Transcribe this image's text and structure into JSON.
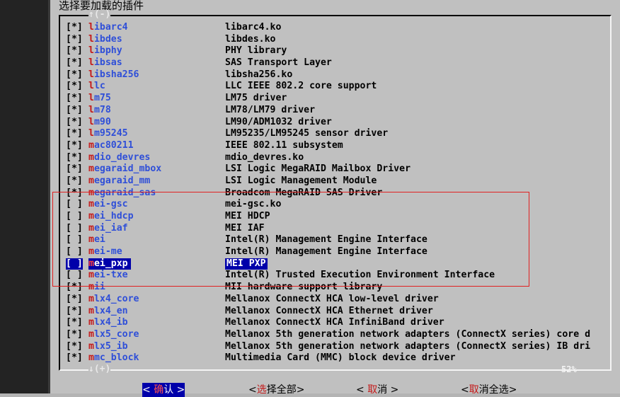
{
  "dialog": {
    "title": "选择要加载的插件",
    "scroll_up": "↑(-)",
    "scroll_down": "↓(+)",
    "percent": "52%"
  },
  "items": [
    {
      "checked": "[*]",
      "hot": "l",
      "rest": "ibarc4",
      "desc": "libarc4.ko"
    },
    {
      "checked": "[*]",
      "hot": "l",
      "rest": "ibdes",
      "desc": "libdes.ko"
    },
    {
      "checked": "[*]",
      "hot": "l",
      "rest": "ibphy",
      "desc": "PHY library"
    },
    {
      "checked": "[*]",
      "hot": "l",
      "rest": "ibsas",
      "desc": "SAS Transport Layer"
    },
    {
      "checked": "[*]",
      "hot": "l",
      "rest": "ibsha256",
      "desc": "libsha256.ko"
    },
    {
      "checked": "[*]",
      "hot": "l",
      "rest": "lc",
      "desc": "LLC IEEE 802.2 core support"
    },
    {
      "checked": "[*]",
      "hot": "l",
      "rest": "m75",
      "desc": "LM75 driver"
    },
    {
      "checked": "[*]",
      "hot": "l",
      "rest": "m78",
      "desc": "LM78/LM79 driver"
    },
    {
      "checked": "[*]",
      "hot": "l",
      "rest": "m90",
      "desc": "LM90/ADM1032 driver"
    },
    {
      "checked": "[*]",
      "hot": "l",
      "rest": "m95245",
      "desc": "LM95235/LM95245 sensor driver"
    },
    {
      "checked": "[*]",
      "hot": "m",
      "rest": "ac80211",
      "desc": "IEEE 802.11 subsystem"
    },
    {
      "checked": "[*]",
      "hot": "m",
      "rest": "dio_devres",
      "desc": "mdio_devres.ko"
    },
    {
      "checked": "[*]",
      "hot": "m",
      "rest": "egaraid_mbox",
      "desc": "LSI Logic MegaRAID Mailbox Driver"
    },
    {
      "checked": "[*]",
      "hot": "m",
      "rest": "egaraid_mm",
      "desc": "LSI Logic Management Module"
    },
    {
      "checked": "[*]",
      "hot": "m",
      "rest": "egaraid_sas",
      "desc": "Broadcom MegaRAID SAS Driver"
    },
    {
      "checked": "[ ]",
      "hot": "m",
      "rest": "ei-gsc",
      "desc": "mei-gsc.ko"
    },
    {
      "checked": "[ ]",
      "hot": "m",
      "rest": "ei_hdcp",
      "desc": "MEI HDCP"
    },
    {
      "checked": "[ ]",
      "hot": "m",
      "rest": "ei_iaf",
      "desc": "MEI IAF"
    },
    {
      "checked": "[ ]",
      "hot": "m",
      "rest": "ei",
      "desc": "Intel(R) Management Engine Interface"
    },
    {
      "checked": "[ ]",
      "hot": "m",
      "rest": "ei-me",
      "desc": "Intel(R) Management Engine Interface"
    },
    {
      "checked": "[ ]",
      "hot": "m",
      "rest": "ei_pxp",
      "desc": "MEI PXP",
      "selected": true
    },
    {
      "checked": "[ ]",
      "hot": "m",
      "rest": "ei-txe",
      "desc": "Intel(R) Trusted Execution Environment Interface"
    },
    {
      "checked": "[*]",
      "hot": "m",
      "rest": "ii",
      "desc": "MII hardware support library"
    },
    {
      "checked": "[*]",
      "hot": "m",
      "rest": "lx4_core",
      "desc": "Mellanox ConnectX HCA low-level driver"
    },
    {
      "checked": "[*]",
      "hot": "m",
      "rest": "lx4_en",
      "desc": "Mellanox ConnectX HCA Ethernet driver"
    },
    {
      "checked": "[*]",
      "hot": "m",
      "rest": "lx4_ib",
      "desc": "Mellanox ConnectX HCA InfiniBand driver"
    },
    {
      "checked": "[*]",
      "hot": "m",
      "rest": "lx5_core",
      "desc": "Mellanox 5th generation network adapters (ConnectX series) core d"
    },
    {
      "checked": "[*]",
      "hot": "m",
      "rest": "lx5_ib",
      "desc": "Mellanox 5th generation network adapters (ConnectX series) IB dri"
    },
    {
      "checked": "[*]",
      "hot": "m",
      "rest": "mc_block",
      "desc": "Multimedia Card (MMC) block device driver"
    }
  ],
  "buttons": {
    "ok": {
      "pre": "< ",
      "hot": "确",
      "post": "认  >"
    },
    "select_all": {
      "pre": "<",
      "hot": "选",
      "post": "择全部>"
    },
    "cancel": {
      "pre": "<  ",
      "hot": "取",
      "post": "消   >"
    },
    "deselect_all": {
      "pre": "<",
      "hot": "取",
      "post": "消全选>"
    }
  },
  "colors": {
    "dialog_bg": "#c0c0c0",
    "selection": "#0000aa",
    "hotkey": "#c41818",
    "item_name": "#2f4fd8",
    "annotation": "#e02020"
  }
}
